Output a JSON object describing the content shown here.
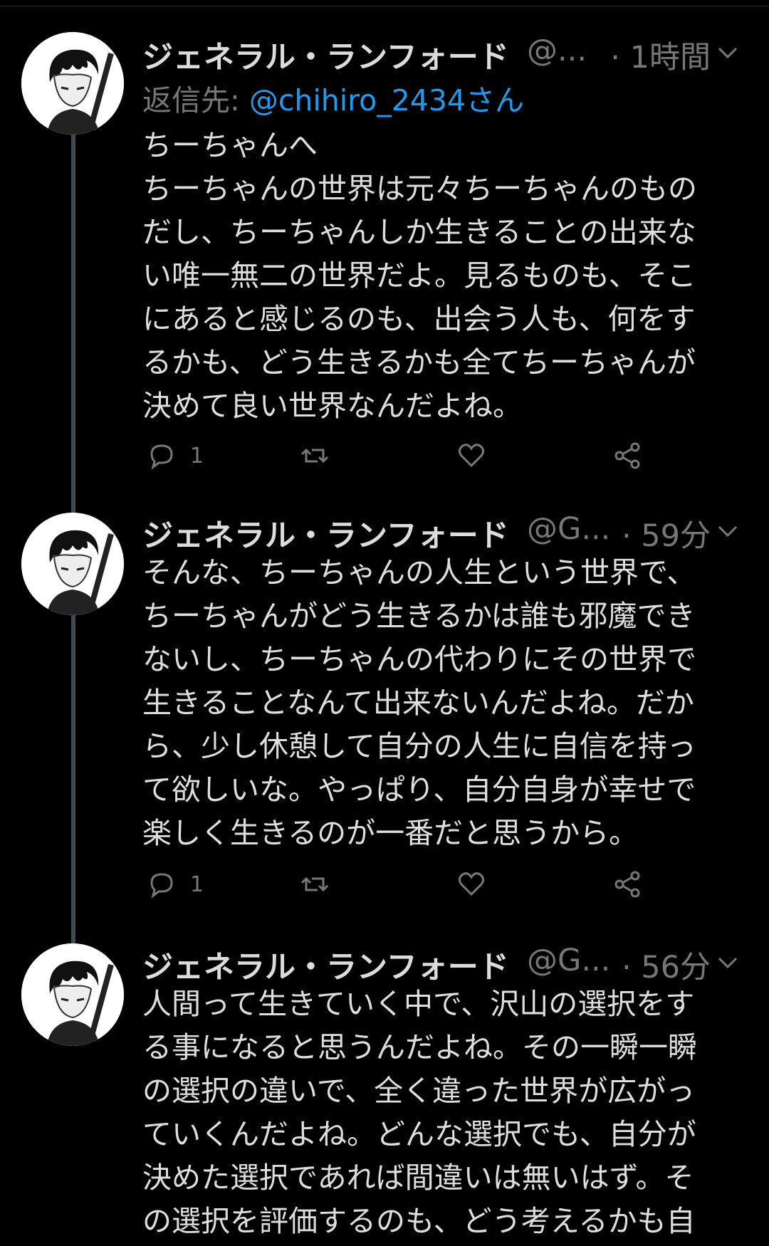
{
  "tweets": [
    {
      "display_name": "ジェネラル・ランフォード",
      "handle": "@...",
      "time": "· 1時間",
      "reply_label": "返信先: ",
      "reply_mention": "@chihiro_2434さん",
      "lines": [
        "ちーちゃんへ",
        "ちーちゃんの世界は元々ちーちゃんのもの",
        "だし、ちーちゃんしか生きることの出来な",
        "い唯一無二の世界だよ。見るものも、そこ",
        "にあると感じるのも、出会う人も、何をす",
        "るかも、どう生きるかも全てちーちゃんが",
        "決めて良い世界なんだよね。"
      ],
      "reply_count": "1",
      "retweet_count": "",
      "like_count": ""
    },
    {
      "display_name": "ジェネラル・ランフォード",
      "handle": "@G...",
      "time": "· 59分",
      "lines": [
        "そんな、ちーちゃんの人生という世界で、",
        "ちーちゃんがどう生きるかは誰も邪魔でき",
        "ないし、ちーちゃんの代わりにその世界で",
        "生きることなんて出来ないんだよね。だか",
        "ら、少し休憩して自分の人生に自信を持っ",
        "て欲しいな。やっぱり、自分自身が幸せで",
        "楽しく生きるのが一番だと思うから。"
      ],
      "reply_count": "1",
      "retweet_count": "",
      "like_count": ""
    },
    {
      "display_name": "ジェネラル・ランフォード",
      "handle": "@G...",
      "time": "· 56分",
      "lines": [
        "人間って生きていく中で、沢山の選択をす",
        "る事になると思うんだよね。その一瞬一瞬",
        "の選択の違いで、全く違った世界が広がっ",
        "ていくんだよね。どんな選択でも、自分が",
        "決めた選択であれば間違いは無いはず。そ",
        "の選択を評価するのも、どう考えるかも自"
      ]
    }
  ],
  "icons": {
    "reply": "reply-icon",
    "retweet": "retweet-icon",
    "like": "heart-icon",
    "share": "share-icon",
    "menu": "chevron-down-icon"
  },
  "colors": {
    "background": "#000000",
    "text": "#d9d9d9",
    "muted": "#777777",
    "link": "#1d9bf0",
    "thread_line": "#3d4a52"
  }
}
